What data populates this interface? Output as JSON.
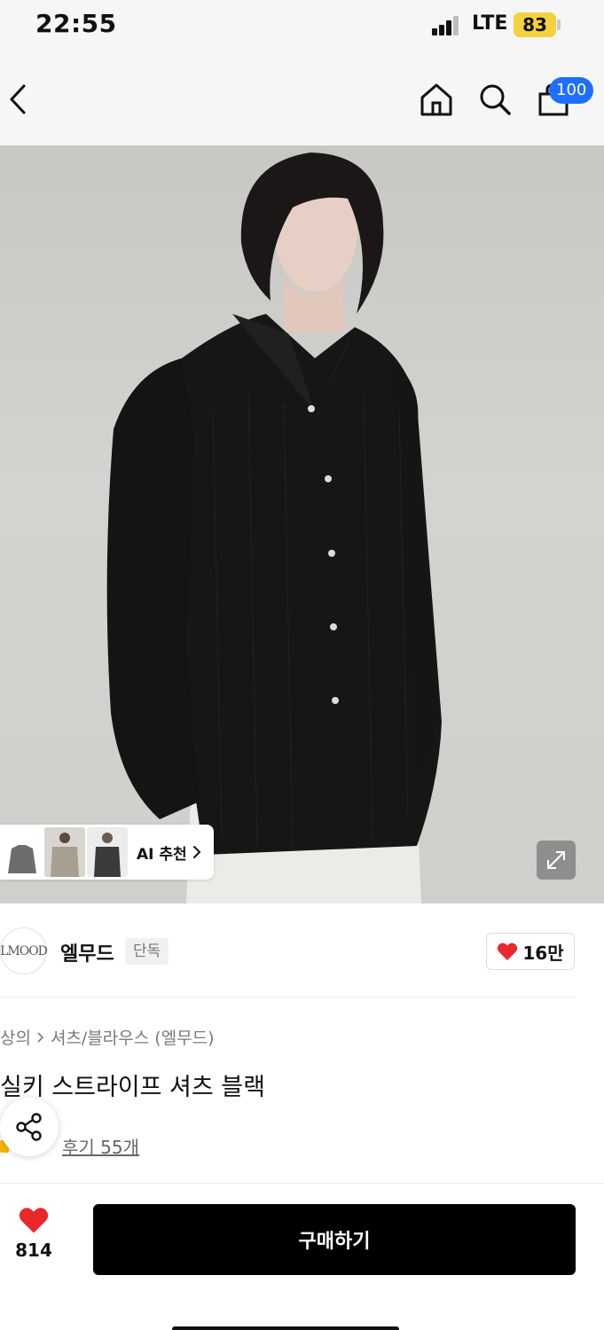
{
  "status_bar": {
    "time": "22:55",
    "network": "LTE",
    "battery": "83",
    "icons": [
      "signal-icon",
      "battery-icon"
    ]
  },
  "nav": {
    "icons": [
      "back-icon",
      "home-icon",
      "search-icon",
      "cart-icon"
    ],
    "cart_badge": "100",
    "badge_color": "#1f6fff"
  },
  "image": {
    "ai_recommend_label": "AI 추천",
    "icons": [
      "chevron-right-icon",
      "expand-icon"
    ]
  },
  "brand": {
    "logo_text": "LMOOD",
    "name": "엘무드",
    "tag": "단독",
    "likes": "16만",
    "heart_color": "#e8282b"
  },
  "product": {
    "breadcrumb": [
      "상의",
      "셔츠/블라우스 (엘무드)"
    ],
    "title": "실키 스트라이프 셔츠 블랙",
    "reviews": "후기 55개",
    "icons": [
      "share-icon",
      "star-icon"
    ]
  },
  "bottom_bar": {
    "wish_count": "814",
    "buy_label": "구매하기",
    "icons": [
      "heart-icon"
    ]
  }
}
